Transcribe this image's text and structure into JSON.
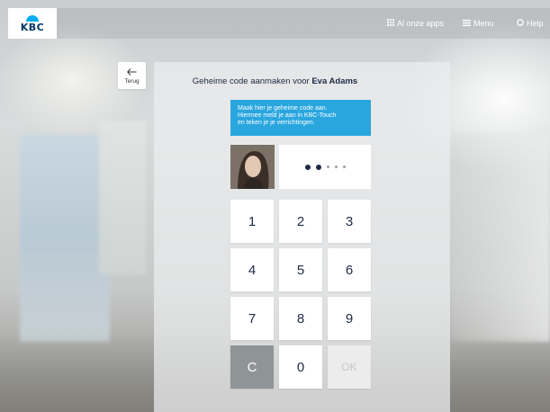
{
  "header": {
    "logo_text": "KBC",
    "nav": [
      {
        "icon": "grid-icon",
        "label": "Al onze apps"
      },
      {
        "icon": "hamburger-icon",
        "label": "Menu"
      },
      {
        "icon": "help-circle-icon",
        "label": "Help"
      }
    ]
  },
  "back": {
    "label": "Terug",
    "icon": "arrow-left-icon"
  },
  "main": {
    "title_prefix": "Geheime code aanmaken voor",
    "title_name": "Eva Adams",
    "info_lines": [
      "Maak hier je geheime code aan.",
      "Hiermee meld je aan  in KBC-Touch",
      "en teken je je verrichtingen."
    ],
    "pin": {
      "entered": 2,
      "length": 5
    },
    "keypad": [
      "1",
      "2",
      "3",
      "4",
      "5",
      "6",
      "7",
      "8",
      "9",
      "C",
      "0",
      "OK"
    ]
  },
  "colors": {
    "accent": "#2aa6df",
    "brand_dark": "#003665",
    "text_dark": "#1f2a44",
    "clear_key": "#8f9497",
    "ok_disabled": "#c4c6c8"
  }
}
